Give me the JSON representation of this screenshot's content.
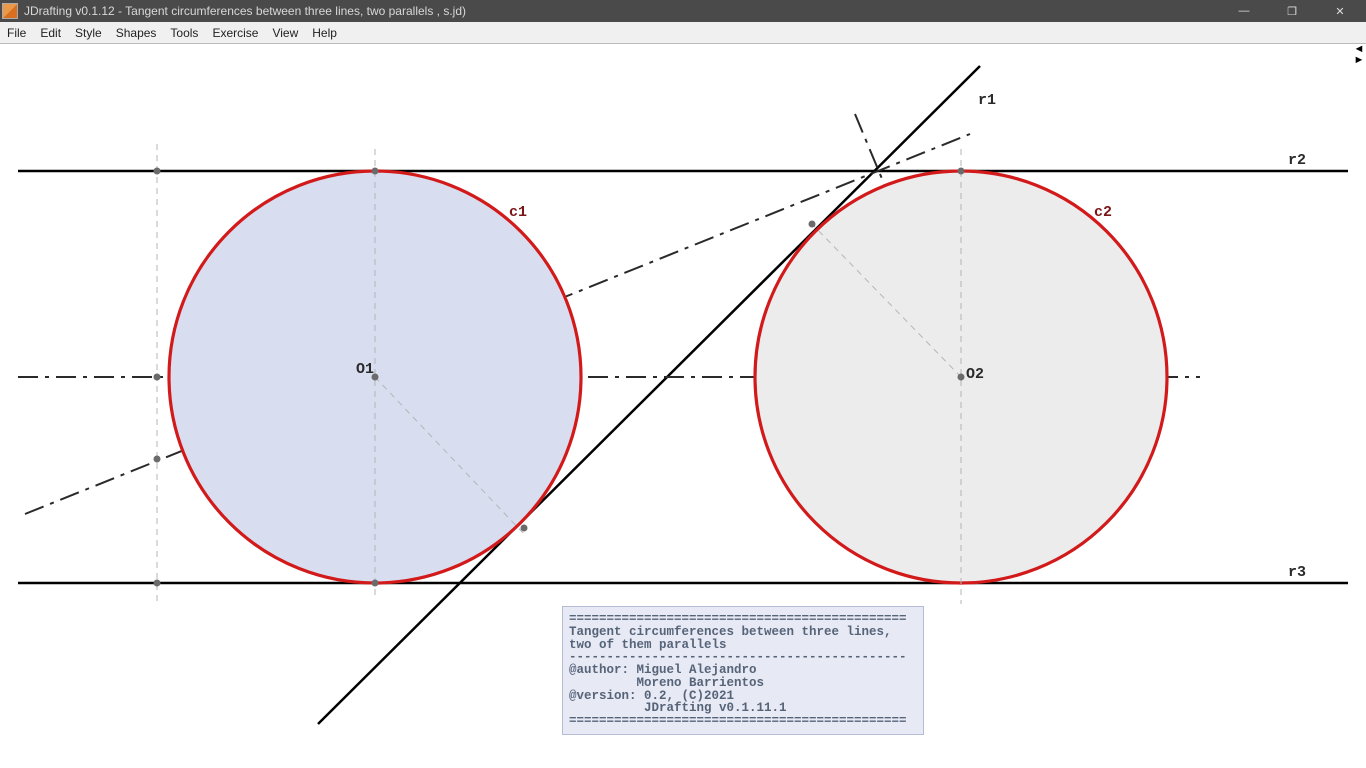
{
  "window": {
    "title": "JDrafting   v0.1.12 - Tangent circumferences between three lines, two parallels ,                                                                                                                                                                                                                    s.jd)"
  },
  "menubar": {
    "items": [
      "File",
      "Edit",
      "Style",
      "Shapes",
      "Tools",
      "Exercise",
      "View",
      "Help"
    ]
  },
  "labels": {
    "r1": "r1",
    "r2": "r2",
    "r3": "r3",
    "c1": "c1",
    "c2": "c2",
    "o1": "O1",
    "o2": "O2"
  },
  "infobox": {
    "sep": "=============================================",
    "line1": "Tangent circumferences between three lines,",
    "line2": "two of them parallels",
    "dash": "---------------------------------------------",
    "auth1": "@author: Miguel Alejandro",
    "auth2": "         Moreno Barrientos",
    "ver": "@version: 0.2, (C)2021",
    "app": "          JDrafting v0.1.11.1"
  }
}
